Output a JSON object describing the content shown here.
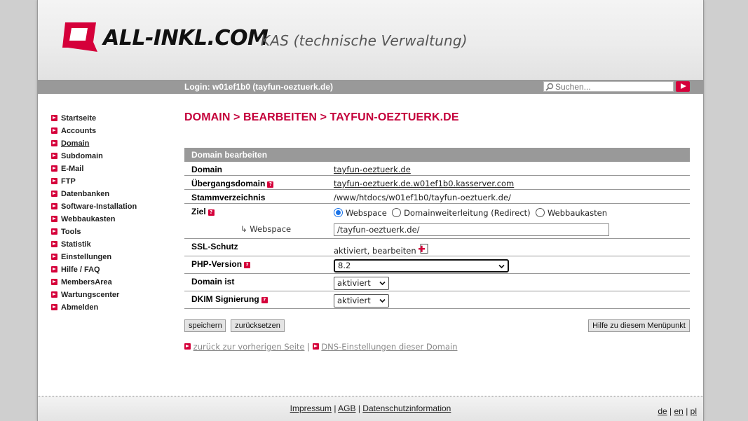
{
  "brand": {
    "logo_text": "ALL-INKL.COM",
    "app_title": "KAS (technische Verwaltung)",
    "accent_color": "#d5003a"
  },
  "loginbar": {
    "login_text": "Login: w01ef1b0 (tayfun-oeztuerk.de)",
    "search_placeholder": "Suchen..."
  },
  "sidebar": {
    "items": [
      {
        "label": "Startseite",
        "active": false
      },
      {
        "label": "Accounts",
        "active": false
      },
      {
        "label": "Domain",
        "active": true
      },
      {
        "label": "Subdomain",
        "active": false
      },
      {
        "label": "E-Mail",
        "active": false
      },
      {
        "label": "FTP",
        "active": false
      },
      {
        "label": "Datenbanken",
        "active": false
      },
      {
        "label": "Software-Installation",
        "active": false
      },
      {
        "label": "Webbaukasten",
        "active": false
      },
      {
        "label": "Tools",
        "active": false
      },
      {
        "label": "Statistik",
        "active": false
      },
      {
        "label": "Einstellungen",
        "active": false
      },
      {
        "label": "Hilfe / FAQ",
        "active": false
      },
      {
        "label": "MembersArea",
        "active": false
      },
      {
        "label": "Wartungscenter",
        "active": false
      },
      {
        "label": "Abmelden",
        "active": false
      }
    ]
  },
  "main": {
    "page_title": "DOMAIN > BEARBEITEN > TAYFUN-OEZTUERK.DE",
    "panel_title": "Domain bearbeiten",
    "rows": {
      "domain": {
        "label": "Domain",
        "value": "tayfun-oeztuerk.de"
      },
      "uebergang": {
        "label": "Übergangsdomain",
        "value": "tayfun-oeztuerk.de.w01ef1b0.kasserver.com"
      },
      "stamm": {
        "label": "Stammverzeichnis",
        "value": "/www/htdocs/w01ef1b0/tayfun-oeztuerk.de/"
      },
      "ziel": {
        "label": "Ziel",
        "options": [
          "Webspace",
          "Domainweiterleitung (Redirect)",
          "Webbaukasten"
        ],
        "selected": "Webspace"
      },
      "webspace": {
        "label": "↳ Webspace",
        "value": "/tayfun-oeztuerk.de/"
      },
      "ssl": {
        "label": "SSL-Schutz",
        "value": "aktiviert,",
        "link": "bearbeiten"
      },
      "php": {
        "label": "PHP-Version",
        "value": "8.2"
      },
      "domain_ist": {
        "label": "Domain ist",
        "value": "aktiviert"
      },
      "dkim": {
        "label": "DKIM Signierung",
        "value": "aktiviert"
      }
    },
    "buttons": {
      "save": "speichern",
      "reset": "zurücksetzen",
      "help": "Hilfe zu diesem Menüpunkt"
    },
    "links": {
      "back": "zurück zur vorherigen Seite",
      "separator": "|",
      "dns": "DNS-Einstellungen dieser Domain"
    }
  },
  "footer": {
    "impressum": "Impressum",
    "sep1": "|",
    "agb": "AGB",
    "sep2": "|",
    "datenschutz": "Datenschutzinformation",
    "lang_de": "de",
    "lang_sep1": "|",
    "lang_en": "en",
    "lang_sep2": "|",
    "lang_pl": "pl"
  }
}
